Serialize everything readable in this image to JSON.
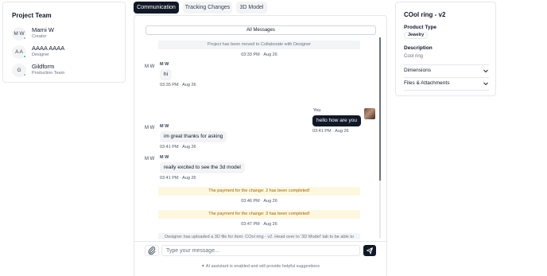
{
  "team": {
    "title": "Project Team",
    "members": [
      {
        "initials": "M W",
        "name": "Marni W",
        "role": "Creator",
        "online": false
      },
      {
        "initials": "A A",
        "name": "AAAA AAAA",
        "role": "Designer",
        "online": true
      },
      {
        "initials": "G",
        "name": "Gildform",
        "role": "Production Team",
        "online": false
      }
    ]
  },
  "tabs": [
    {
      "label": "Communication",
      "active": true
    },
    {
      "label": "Tracking Changes",
      "active": false
    },
    {
      "label": "3D Model",
      "active": false
    }
  ],
  "chat": {
    "filter_label": "All Messages",
    "messages": [
      {
        "kind": "system",
        "text": "Project has been moved to Collaborate with Designer",
        "time": "03:33 PM · Aug 26"
      },
      {
        "kind": "received",
        "initials": "M W",
        "sender": "M W",
        "text": "hi",
        "time": "03:35 PM · Aug 26"
      },
      {
        "kind": "sent",
        "sender": "You",
        "text": "hello how are you",
        "time": "03:41 PM · Aug 26"
      },
      {
        "kind": "received",
        "initials": "M W",
        "sender": "M W",
        "text": "im great thanks for asking",
        "time": "03:41 PM · Aug 26"
      },
      {
        "kind": "received",
        "initials": "M W",
        "sender": "M W",
        "text": "really excited to see the 3d model",
        "time": "03:41 PM · Aug 26"
      },
      {
        "kind": "payment",
        "text": "The payment for the change: 2 has been completed!",
        "time": "03:46 PM · Aug 26"
      },
      {
        "kind": "payment",
        "text": "The payment for the change: 3 has been completed!",
        "time": "03:47 PM · Aug 26"
      },
      {
        "kind": "system",
        "text": "Designer has uploaded a 3D file for item: COol ring - v2. Head over to '3D Model' tab to be able to"
      }
    ],
    "input_placeholder": "Type your message...",
    "ai_note": "AI assistant is enabled and will provide helpful suggestions"
  },
  "details": {
    "title": "COol ring - v2",
    "product_type_label": "Product Type",
    "product_type_value": "Jewelry",
    "description_label": "Description",
    "description_value": "Cool ring",
    "sections": [
      "Dimensions",
      "Files & Attachments"
    ]
  },
  "colors": {
    "primary": "#111827",
    "online": "#22c55e",
    "payment_bg": "#fef7e0",
    "payment_text": "#a16207"
  },
  "icons": [
    "paperclip-icon",
    "send-icon",
    "sparkle-icon",
    "chevron-down-icon"
  ]
}
